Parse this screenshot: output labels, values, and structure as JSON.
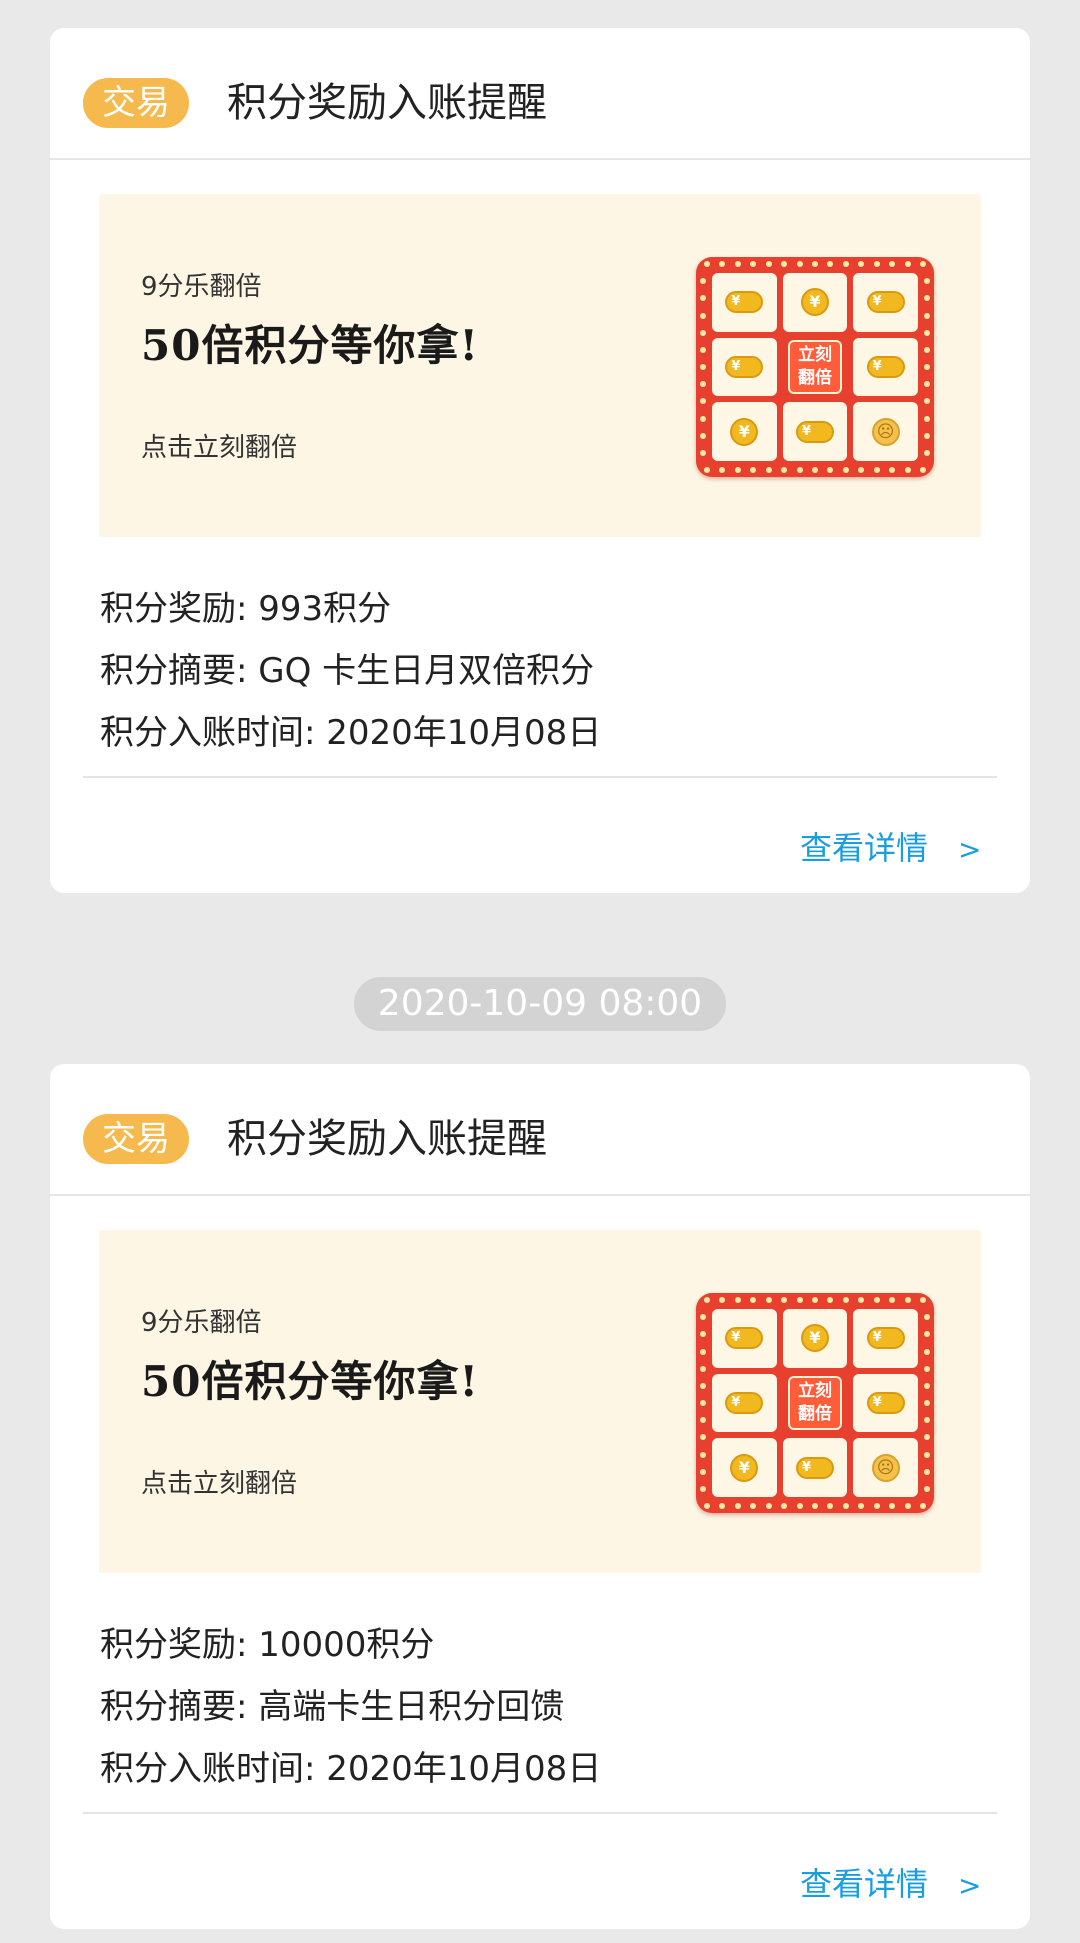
{
  "messages": [
    {
      "tag": "交易",
      "title": "积分奖励入账提醒",
      "banner": {
        "subtitle": "9分乐翻倍",
        "headline": "50倍积分等你拿!",
        "cta": "点击立刻翻倍",
        "game_center_label": "立刻\n翻倍"
      },
      "reward_line": "积分奖励: 993积分",
      "summary_line": "积分摘要: GQ 卡生日月双倍积分",
      "time_line": "积分入账时间: 2020年10月08日",
      "detail_label": "查看详情",
      "detail_arrow": ">"
    },
    {
      "tag": "交易",
      "title": "积分奖励入账提醒",
      "banner": {
        "subtitle": "9分乐翻倍",
        "headline": "50倍积分等你拿!",
        "cta": "点击立刻翻倍",
        "game_center_label": "立刻\n翻倍"
      },
      "reward_line": "积分奖励: 10000积分",
      "summary_line": "积分摘要: 高端卡生日积分回馈",
      "time_line": "积分入账时间: 2020年10月08日",
      "detail_label": "查看详情",
      "detail_arrow": ">"
    }
  ],
  "timestamp": "2020-10-09 08:00",
  "colors": {
    "background": "#e9e9e9",
    "tag": "#f6b94d",
    "banner": "#fdf6e4",
    "link": "#1b9ee0",
    "board": "#e8402f"
  },
  "icons": {
    "coin": "yuan-coin-icon",
    "coin_stack": "coin-stack-icon",
    "sad": "sad-coin-icon"
  }
}
